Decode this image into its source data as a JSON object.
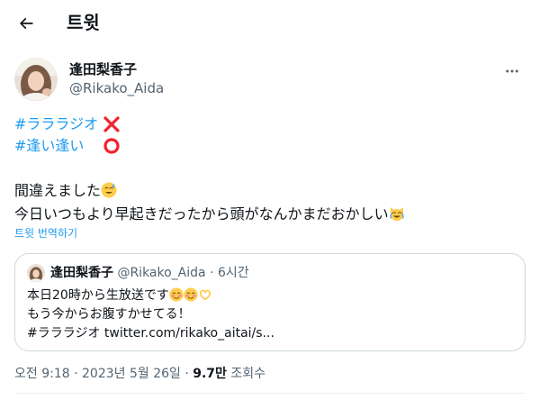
{
  "header": {
    "title": "트윗"
  },
  "author": {
    "name": "逢田梨香子",
    "handle": "@Rikako_Aida"
  },
  "tweet": {
    "hashtag1": "#ラララジオ",
    "hashtag2": "#逢い逢い",
    "line1": "間違えました",
    "line2": "今日いつもより早起きだったから頭がなんかまだおかしい",
    "translate": "트윗 번역하기"
  },
  "quote": {
    "name": "逢田梨香子",
    "handle": "@Rikako_Aida",
    "time": "· 6시간",
    "line1": "本日20時から生放送です",
    "line2": "もう今からお腹すかせてる！",
    "hashtag": "#ラララジオ",
    "link": "twitter.com/rikako_aitai/s..."
  },
  "meta": {
    "time": "오전 9:18 · 2023년 5월 26일 ·",
    "views": "9.7만",
    "views_label": "조회수"
  },
  "colors": {
    "accent": "#1d9bf0",
    "mark_red": "#f4212e",
    "secondary_text": "#536471",
    "border": "#cfd9de"
  },
  "icons": {
    "back": "arrow-left-icon",
    "more": "more-horizontal-icon",
    "cross": "cross-mark-icon",
    "circle": "circle-mark-icon",
    "emoji_sweat_smile": "sweat-smile-emoji",
    "emoji_joy_cat": "joy-cat-emoji",
    "emoji_smiling": "smiling-blush-emoji",
    "emoji_heart_hands": "heart-hands-emoji"
  }
}
